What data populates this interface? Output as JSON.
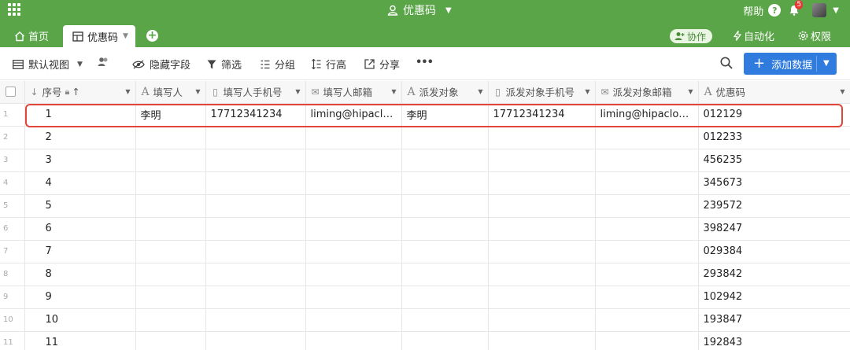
{
  "header": {
    "app_title": "优惠码",
    "help_label": "帮助",
    "help_icon_text": "?",
    "notification_count": "5"
  },
  "tabs": {
    "home_label": "首页",
    "active_label": "优惠码",
    "add_symbol": "+"
  },
  "actions": {
    "collab_label": "协作",
    "automation_label": "自动化",
    "permission_label": "权限"
  },
  "toolbar": {
    "view_label": "默认视图",
    "hide_fields_label": "隐藏字段",
    "filter_label": "筛选",
    "group_label": "分组",
    "row_height_label": "行高",
    "share_label": "分享",
    "more_label": "•••",
    "add_data_label": "添加数据",
    "add_data_plus": "+"
  },
  "table": {
    "columns": [
      {
        "label": "序号",
        "icon": "sort-number-icon"
      },
      {
        "label": "填写人",
        "icon": "text-field-icon"
      },
      {
        "label": "填写人手机号",
        "icon": "phone-field-icon"
      },
      {
        "label": "填写人邮箱",
        "icon": "email-field-icon"
      },
      {
        "label": "派发对象",
        "icon": "text-field-icon"
      },
      {
        "label": "派发对象手机号",
        "icon": "phone-field-icon"
      },
      {
        "label": "派发对象邮箱",
        "icon": "email-field-icon"
      },
      {
        "label": "优惠码",
        "icon": "text-field-icon"
      }
    ],
    "rows": [
      {
        "rownum": "1",
        "seq": "1",
        "filler": "李明",
        "filler_phone": "17712341234",
        "filler_email": "liming@hipacloud.com",
        "target": "李明",
        "target_phone": "17712341234",
        "target_email": "liming@hipacloud.com",
        "code": "012129"
      },
      {
        "rownum": "2",
        "seq": "2",
        "filler": "",
        "filler_phone": "",
        "filler_email": "",
        "target": "",
        "target_phone": "",
        "target_email": "",
        "code": "012233"
      },
      {
        "rownum": "3",
        "seq": "3",
        "filler": "",
        "filler_phone": "",
        "filler_email": "",
        "target": "",
        "target_phone": "",
        "target_email": "",
        "code": "456235"
      },
      {
        "rownum": "4",
        "seq": "4",
        "filler": "",
        "filler_phone": "",
        "filler_email": "",
        "target": "",
        "target_phone": "",
        "target_email": "",
        "code": "345673"
      },
      {
        "rownum": "5",
        "seq": "5",
        "filler": "",
        "filler_phone": "",
        "filler_email": "",
        "target": "",
        "target_phone": "",
        "target_email": "",
        "code": "239572"
      },
      {
        "rownum": "6",
        "seq": "6",
        "filler": "",
        "filler_phone": "",
        "filler_email": "",
        "target": "",
        "target_phone": "",
        "target_email": "",
        "code": "398247"
      },
      {
        "rownum": "7",
        "seq": "7",
        "filler": "",
        "filler_phone": "",
        "filler_email": "",
        "target": "",
        "target_phone": "",
        "target_email": "",
        "code": "029384"
      },
      {
        "rownum": "8",
        "seq": "8",
        "filler": "",
        "filler_phone": "",
        "filler_email": "",
        "target": "",
        "target_phone": "",
        "target_email": "",
        "code": "293842"
      },
      {
        "rownum": "9",
        "seq": "9",
        "filler": "",
        "filler_phone": "",
        "filler_email": "",
        "target": "",
        "target_phone": "",
        "target_email": "",
        "code": "102942"
      },
      {
        "rownum": "10",
        "seq": "10",
        "filler": "",
        "filler_phone": "",
        "filler_email": "",
        "target": "",
        "target_phone": "",
        "target_email": "",
        "code": "193847"
      },
      {
        "rownum": "11",
        "seq": "11",
        "filler": "",
        "filler_phone": "",
        "filler_email": "",
        "target": "",
        "target_phone": "",
        "target_email": "",
        "code": "192843"
      }
    ]
  },
  "colors": {
    "brand_green": "#5aa548",
    "primary_blue": "#2f7bde",
    "highlight_red": "#e2463a"
  }
}
